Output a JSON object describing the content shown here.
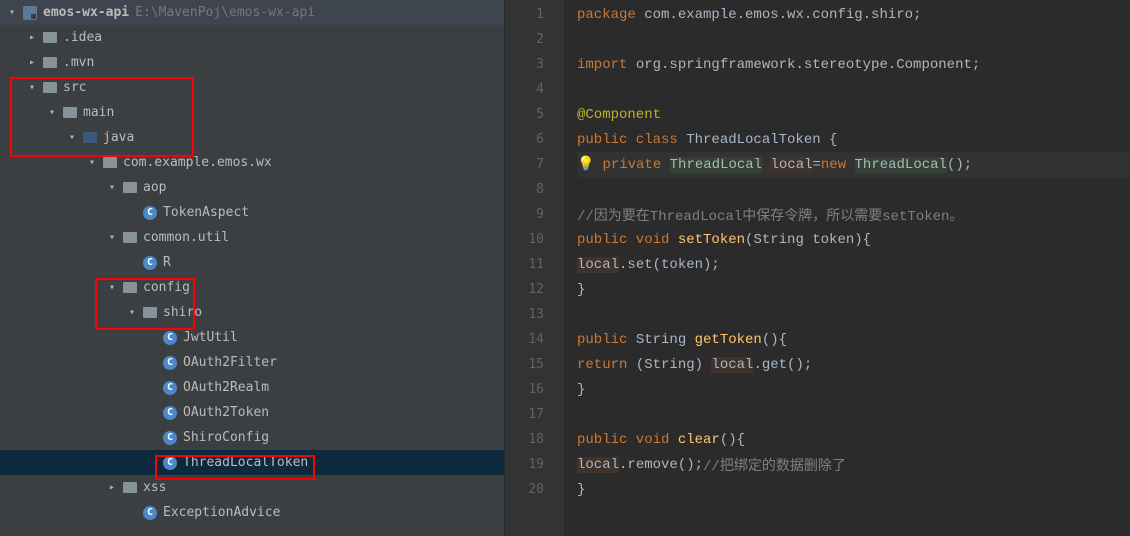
{
  "project": {
    "name": "emos-wx-api",
    "path": "E:\\MavenPoj\\emos-wx-api"
  },
  "tree": {
    "idea": ".idea",
    "mvn": ".mvn",
    "src": "src",
    "main": "main",
    "java": "java",
    "pkg": "com.example.emos.wx",
    "aop": "aop",
    "tokenaspect": "TokenAspect",
    "commonutil": "common.util",
    "r": "R",
    "config": "config",
    "shiro": "shiro",
    "jwtutil": "JwtUtil",
    "oauth2filter": "OAuth2Filter",
    "oauth2realm": "OAuth2Realm",
    "oauth2token": "OAuth2Token",
    "shiroconfig": "ShiroConfig",
    "threadlocaltoken": "ThreadLocalToken",
    "xss": "xss",
    "exceptionadvice": "ExceptionAdvice"
  },
  "code": {
    "l1": {
      "kw1": "package ",
      "rest": "com.example.emos.wx.config.shiro;"
    },
    "l3": {
      "kw1": "import ",
      "rest": "org.springframework.stereotype.Component;"
    },
    "l5": {
      "anno": "@Component"
    },
    "l6": {
      "kw1": "public class ",
      "type": "ThreadLocalToken ",
      "brace": "{"
    },
    "l7": {
      "kw1": "private ",
      "type1": "ThreadLocal",
      "sp": " ",
      "var": "local",
      "eq": "=",
      "kw2": "new ",
      "type2": "ThreadLocal",
      "end": "();"
    },
    "l9": {
      "comment": "//因为要在ThreadLocal中保存令牌，所以需要setToken。"
    },
    "l10": {
      "kw1": "public void ",
      "method": "setToken",
      "params": "(String token){"
    },
    "l11": {
      "var": "local",
      "rest": ".set(token);"
    },
    "l12": {
      "brace": "}"
    },
    "l14": {
      "kw1": "public ",
      "type": "String ",
      "method": "getToken",
      "params": "(){"
    },
    "l15": {
      "kw1": "return ",
      "cast": "(String) ",
      "var": "local",
      "rest": ".get();"
    },
    "l16": {
      "brace": "}"
    },
    "l18": {
      "kw1": "public void ",
      "method": "clear",
      "params": "(){"
    },
    "l19": {
      "var": "local",
      "rest": ".remove();",
      "comment": "//把绑定的数据删除了"
    },
    "l20": {
      "brace": "}"
    }
  },
  "lines": [
    "1",
    "2",
    "3",
    "4",
    "5",
    "6",
    "7",
    "8",
    "9",
    "10",
    "11",
    "12",
    "13",
    "14",
    "15",
    "16",
    "17",
    "18",
    "19",
    "20"
  ]
}
